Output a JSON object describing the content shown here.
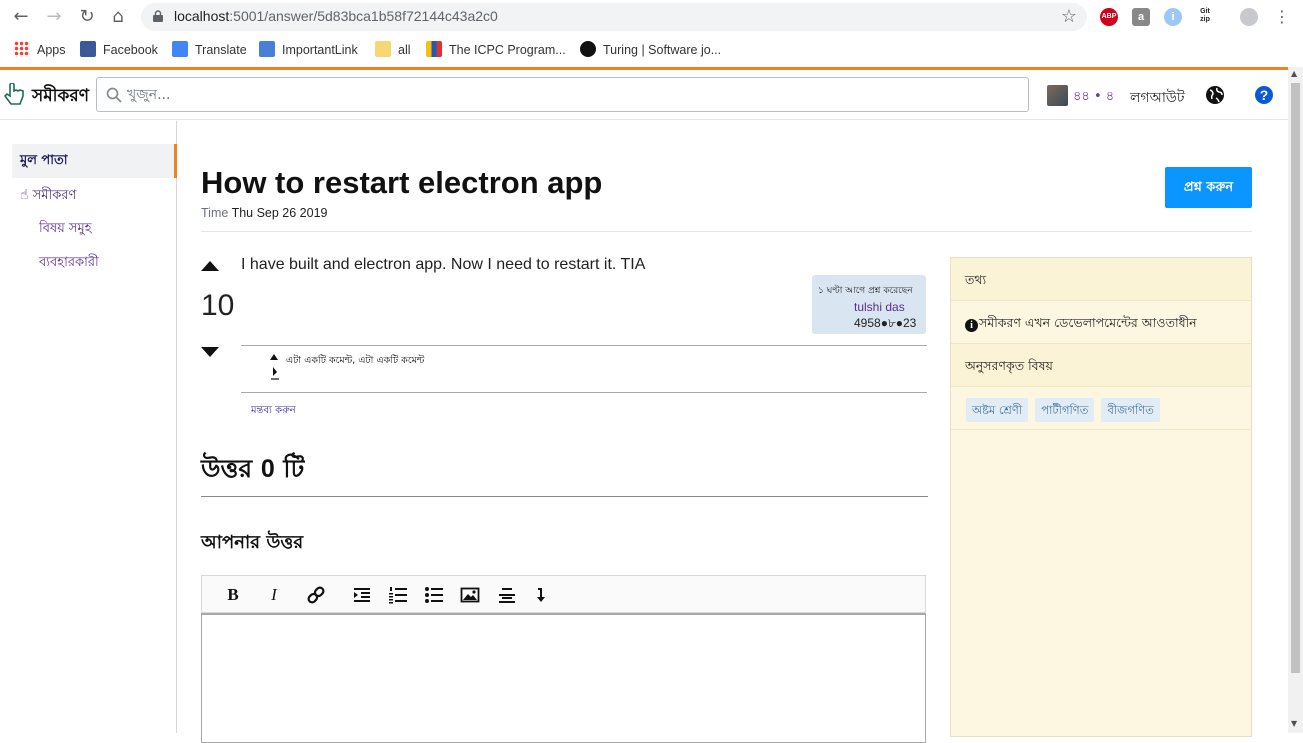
{
  "browser": {
    "url_host": "localhost",
    "url_path": ":5001/answer/5d83bca1b58f72144c43a2c0",
    "extensions": [
      "ABP",
      "a",
      "i",
      "Git zip"
    ],
    "bookmarks": [
      "Apps",
      "Facebook",
      "Translate",
      "ImportantLink",
      "all",
      "The ICPC Program...",
      "Turing | Software jo..."
    ]
  },
  "header": {
    "logo_text": "সমীকরণ",
    "search_placeholder": "খুজুন...",
    "reputation": "৪৪ • ৪",
    "logout_label": "লগআউট"
  },
  "leftnav": {
    "items": [
      {
        "label": "মুল পাতা"
      },
      {
        "label": "সমীকরণ"
      },
      {
        "label": "বিষয় সমুহ"
      },
      {
        "label": "ব্যবহারকারী"
      }
    ]
  },
  "question": {
    "title": "How to restart electron app",
    "time_label": "Time",
    "time_value": "Thu Sep 26 2019",
    "ask_button": "প্রশ্ন করুন",
    "body": "I have built and electron app. Now I need to restart it. TIA",
    "votes": "10",
    "asked_text": "১ ঘণ্টা আগে প্রশ্ন করেছেন",
    "owner_name": "tulshi das",
    "owner_rep": "4958●৮●23",
    "comment_text": "এটা একটি কমেন্ট, এটা একটি কমেন্ট",
    "add_comment": "মন্তব্য করুন"
  },
  "answers": {
    "heading_pre": "উত্তর ",
    "count": "0",
    "heading_post": " টি",
    "your_answer": "আপনার উত্তর"
  },
  "sidebar": {
    "info_title": "তথ্য",
    "dev_notice": "সমীকরণ এখন ডেভেলাপমেন্টের আওতাধীন",
    "followed_title": "অনুসরণকৃত বিষয়",
    "tags": [
      "অষ্টম শ্রেণী",
      "পাটীগণিত",
      "বীজগণিত"
    ]
  }
}
